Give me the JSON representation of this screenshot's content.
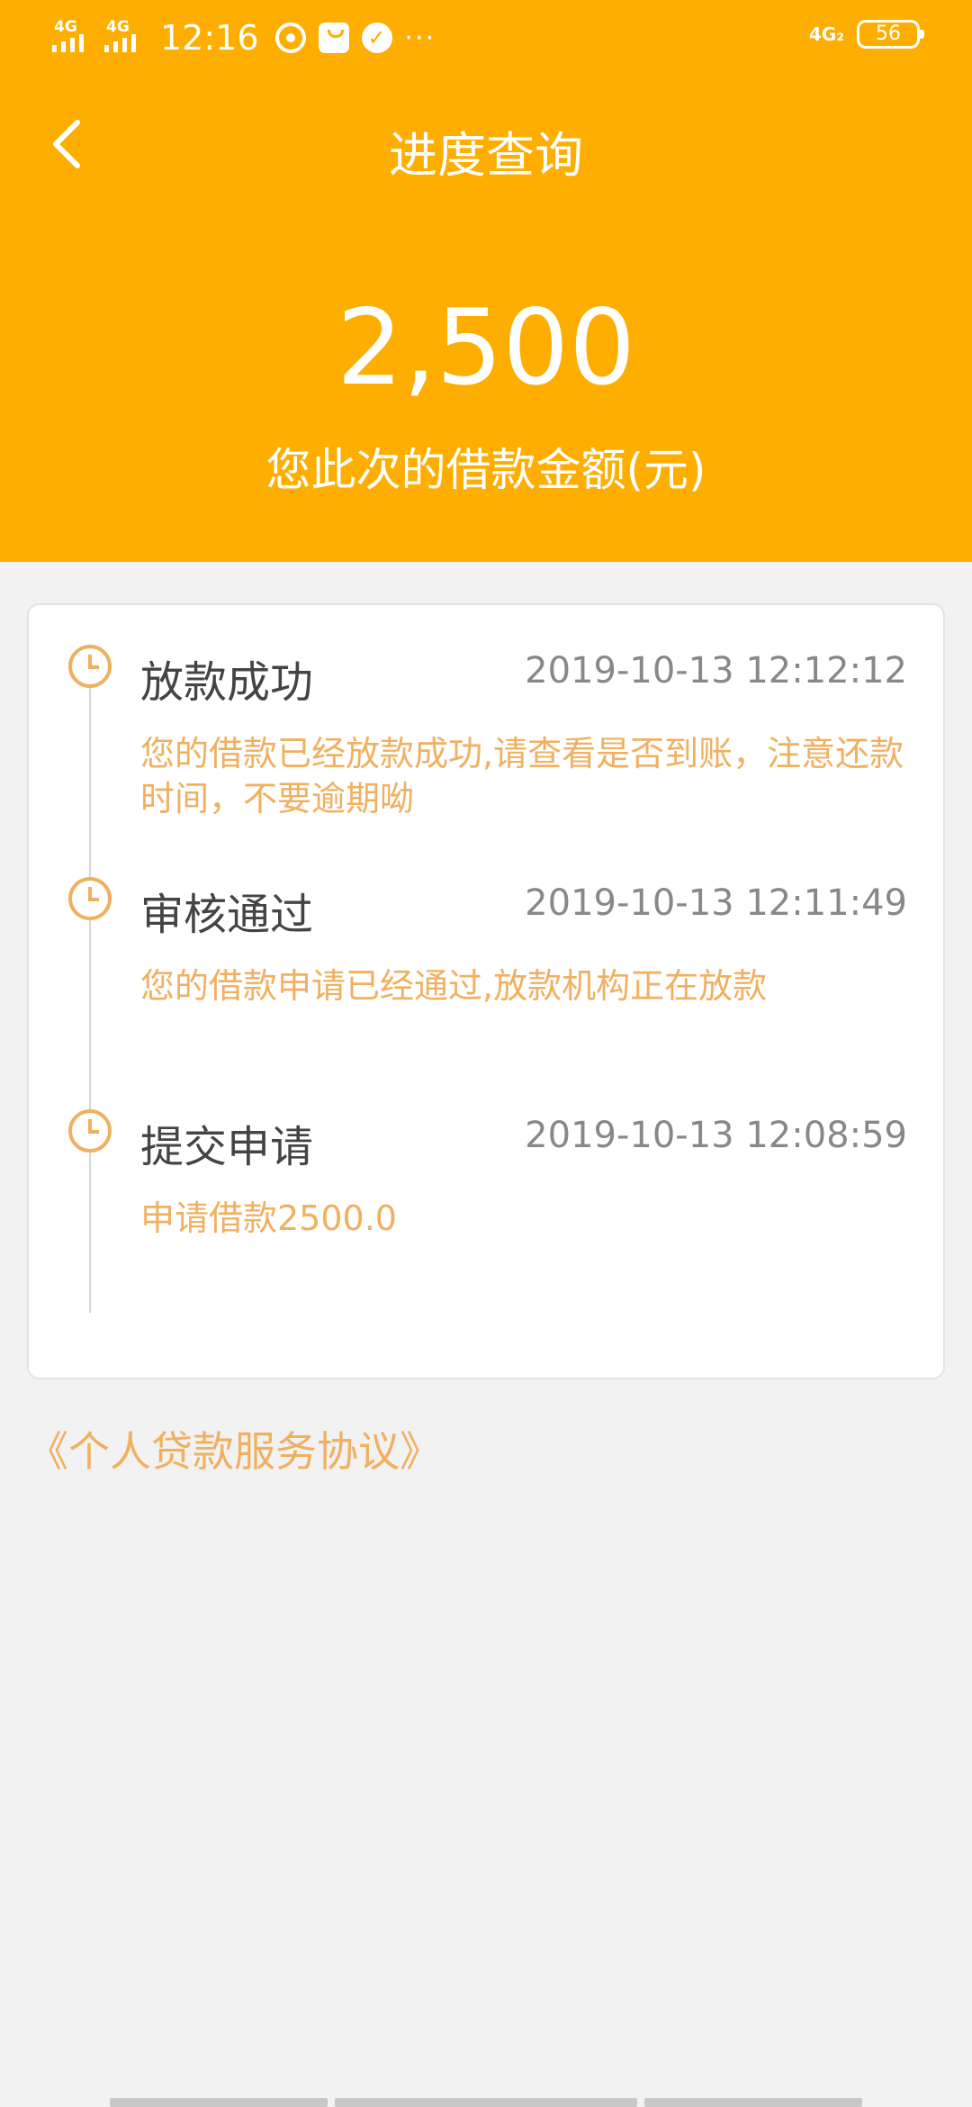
{
  "status_bar": {
    "network_1": "4G",
    "network_2": "4G",
    "time": "12:16",
    "more": "···",
    "network_right": "4G₂",
    "battery": "56"
  },
  "header": {
    "title": "进度查询",
    "amount": "2,500",
    "amount_label": "您此次的借款金额(元)"
  },
  "timeline": [
    {
      "title": "放款成功",
      "time": "2019-10-13 12:12:12",
      "desc": "您的借款已经放款成功,请查看是否到账，注意还款时间，不要逾期呦"
    },
    {
      "title": "审核通过",
      "time": "2019-10-13 12:11:49",
      "desc": "您的借款申请已经通过,放款机构正在放款"
    },
    {
      "title": "提交申请",
      "time": "2019-10-13 12:08:59",
      "desc": "申请借款2500.0"
    }
  ],
  "agreement_link": "《个人贷款服务协议》",
  "colors": {
    "header_bg": "#fdae00",
    "accent_text": "#f1b060",
    "page_bg": "#f2f2f2"
  }
}
